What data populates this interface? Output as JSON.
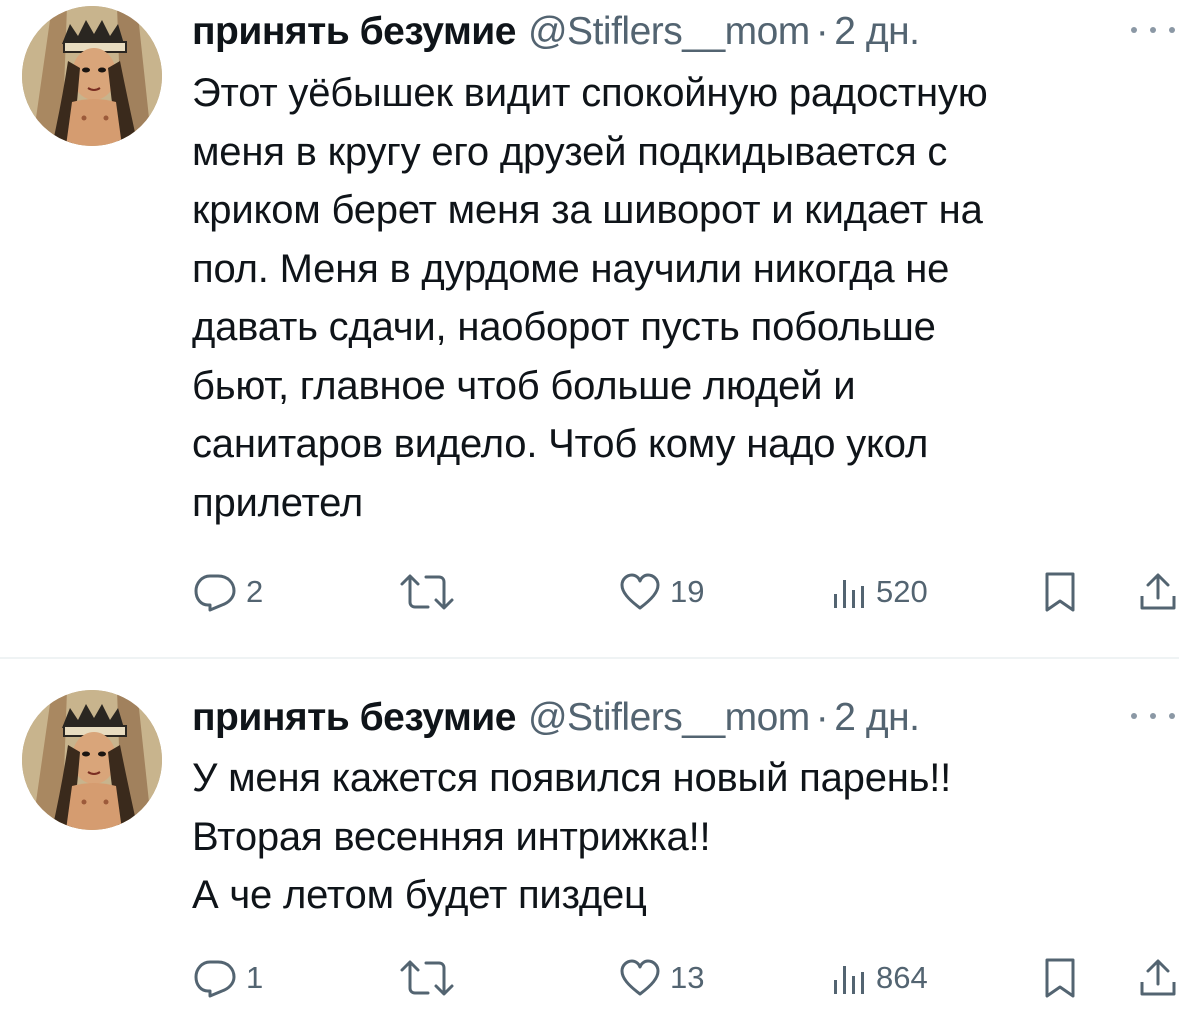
{
  "tweets": [
    {
      "author": {
        "display_name": "принять безумие",
        "handle": "@Stiflers__mom",
        "avatar_icon": "avatar-image"
      },
      "separator": "·",
      "time": "2 дн.",
      "text_lines": [
        "Этот уёбышек видит спокойную радостную",
        "меня в кругу его друзей подкидывается с",
        "криком берет меня за шиворот и кидает на",
        "пол. Меня в дурдоме научили никогда не",
        "давать сдачи, наоборот пусть побольше",
        "бьют, главное чтоб больше людей и",
        "санитаров видело. Чтоб кому надо укол",
        "прилетел"
      ],
      "actions": {
        "replies": "2",
        "retweets": "",
        "likes": "19",
        "views": "520"
      }
    },
    {
      "author": {
        "display_name": "принять безумие",
        "handle": "@Stiflers__mom",
        "avatar_icon": "avatar-image"
      },
      "separator": "·",
      "time": "2 дн.",
      "text_lines": [
        "У меня кажется появился новый парень!!",
        "Вторая весенняя интрижка!!",
        "А че летом будет пиздец"
      ],
      "actions": {
        "replies": "1",
        "retweets": "",
        "likes": "13",
        "views": "864"
      }
    }
  ],
  "colors": {
    "text_primary": "#0f1419",
    "text_secondary": "#536471",
    "divider": "#eff3f4"
  },
  "icons": [
    "reply-icon",
    "retweet-icon",
    "like-icon",
    "views-icon",
    "bookmark-icon",
    "share-icon",
    "more-icon"
  ]
}
